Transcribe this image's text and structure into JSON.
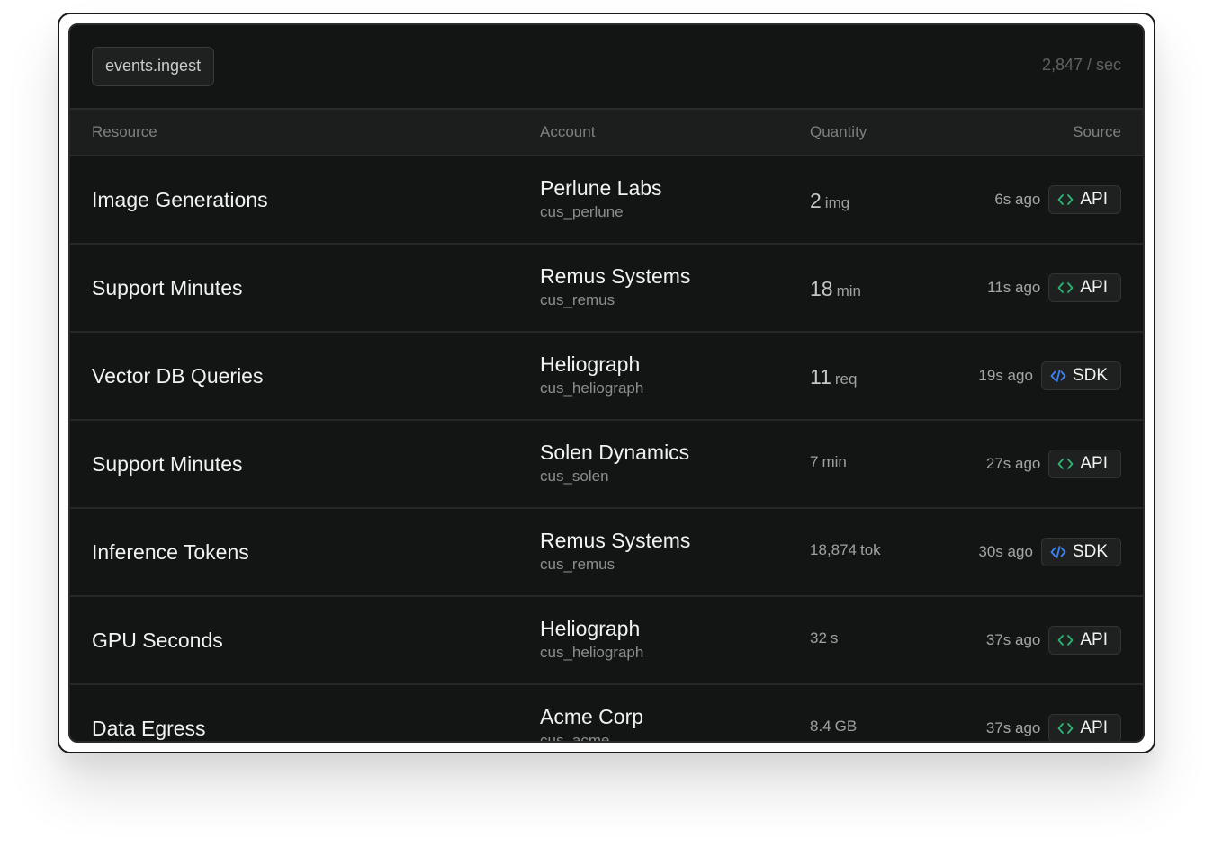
{
  "header": {
    "stream_label": "events.ingest",
    "rate": "2,847 / sec"
  },
  "columns": {
    "resource": "Resource",
    "account": "Account",
    "quantity": "Quantity",
    "source": "Source"
  },
  "colors": {
    "api_icon": "#2fb673",
    "sdk_icon": "#3b82f6"
  },
  "rows": [
    {
      "resource": "Image Generations",
      "account": "Perlune Labs",
      "account_id": "cus_perlune",
      "qty": "2",
      "unit": "img",
      "ago": "6s ago",
      "source": "API",
      "icon": "code-icon"
    },
    {
      "resource": "Support Minutes",
      "account": "Remus Systems",
      "account_id": "cus_remus",
      "qty": "18",
      "unit": "min",
      "ago": "11s ago",
      "source": "API",
      "icon": "code-icon"
    },
    {
      "resource": "Vector DB Queries",
      "account": "Heliograph",
      "account_id": "cus_heliograph",
      "qty": "11",
      "unit": "req",
      "ago": "19s ago",
      "source": "SDK",
      "icon": "code-slash-icon"
    },
    {
      "resource": "Support Minutes",
      "account": "Solen Dynamics",
      "account_id": "cus_solen",
      "qty": "7",
      "unit": "min",
      "ago": "27s ago",
      "source": "API",
      "icon": "code-icon"
    },
    {
      "resource": "Inference Tokens",
      "account": "Remus Systems",
      "account_id": "cus_remus",
      "qty": "18,874",
      "unit": "tok",
      "ago": "30s ago",
      "source": "SDK",
      "icon": "code-slash-icon"
    },
    {
      "resource": "GPU Seconds",
      "account": "Heliograph",
      "account_id": "cus_heliograph",
      "qty": "32",
      "unit": "s",
      "ago": "37s ago",
      "source": "API",
      "icon": "code-icon"
    },
    {
      "resource": "Data Egress",
      "account": "Acme Corp",
      "account_id": "cus_acme",
      "qty": "8.4",
      "unit": "GB",
      "ago": "37s ago",
      "source": "API",
      "icon": "code-icon"
    }
  ]
}
